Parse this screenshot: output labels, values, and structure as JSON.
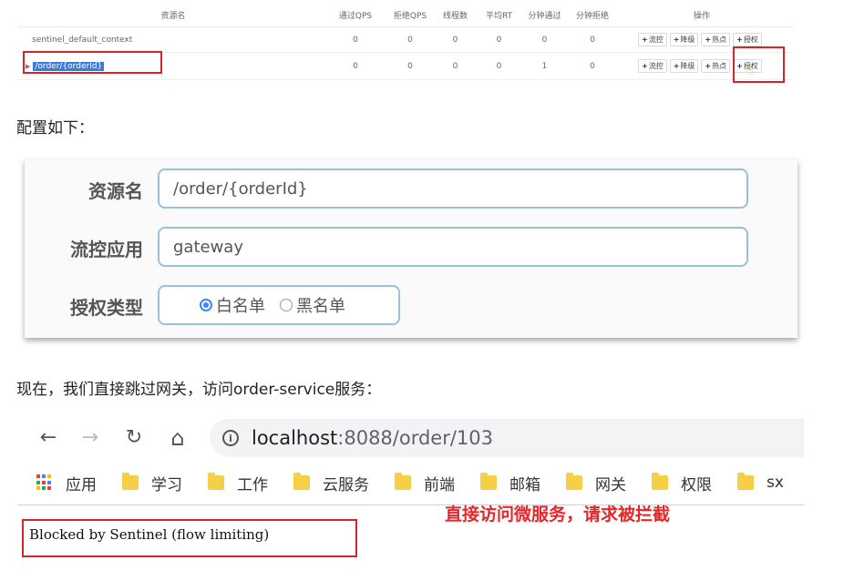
{
  "table": {
    "headers": [
      "资源名",
      "通过QPS",
      "拒绝QPS",
      "线程数",
      "平均RT",
      "分钟通过",
      "分钟拒绝",
      "操作"
    ],
    "rows": [
      {
        "resource": "sentinel_default_context",
        "values": [
          "0",
          "0",
          "0",
          "0",
          "0",
          "0"
        ]
      },
      {
        "resource": "/order/{orderId}",
        "values": [
          "0",
          "0",
          "0",
          "0",
          "1",
          "0"
        ]
      }
    ],
    "actions": [
      "流控",
      "降级",
      "热点",
      "授权"
    ],
    "plus": "+"
  },
  "config_heading": "配置如下：",
  "config": {
    "resource_label": "资源名",
    "resource_value": "/order/{orderId}",
    "app_label": "流控应用",
    "app_value": "gateway",
    "type_label": "授权类型",
    "whitelist": "白名单",
    "blacklist": "黑名单",
    "selected": "白名单"
  },
  "direct_heading": "现在，我们直接跳过网关，访问order-service服务：",
  "browser": {
    "back_icon": "←",
    "forward_icon": "→",
    "reload_icon": "↻",
    "home_icon": "⌂",
    "info_icon": "i",
    "url_host": "localhost",
    "url_rest": ":8088/order/103",
    "apps_label": "应用",
    "bookmarks": [
      "学习",
      "工作",
      "云服务",
      "前端",
      "邮箱",
      "网关",
      "权限",
      "sx"
    ],
    "folder_color": "#f5cf45"
  },
  "annotation": "直接访问微服务，请求被拦截",
  "blocked_message": "Blocked by Sentinel (flow limiting)",
  "colors": {
    "highlight_red": "#d8232a",
    "radio_blue": "#3b86f5",
    "selection_blue": "#3d7bd9",
    "annotation_red": "#e5262b"
  }
}
